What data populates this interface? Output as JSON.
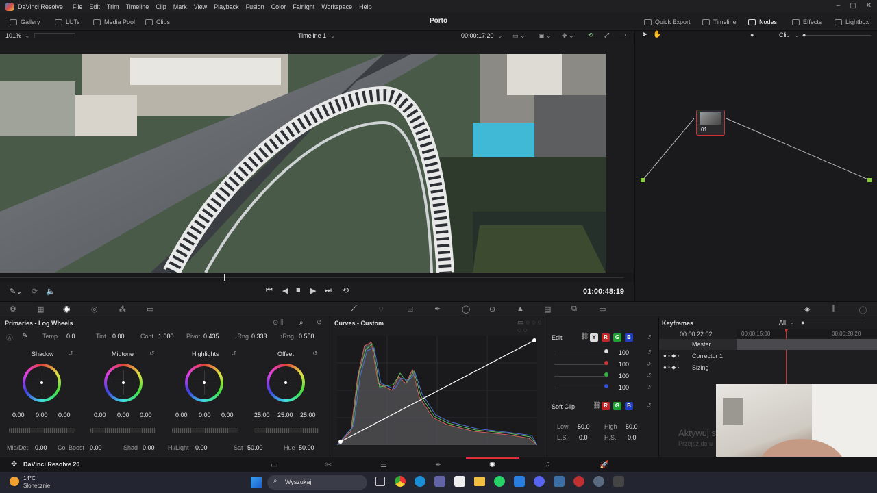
{
  "app": {
    "name": "DaVinci Resolve",
    "menus": [
      "File",
      "Edit",
      "Trim",
      "Timeline",
      "Clip",
      "Mark",
      "View",
      "Playback",
      "Fusion",
      "Color",
      "Fairlight",
      "Workspace",
      "Help"
    ]
  },
  "toolbar": {
    "left": [
      "Gallery",
      "LUTs",
      "Media Pool",
      "Clips"
    ],
    "project": "Porto",
    "right": [
      "Quick Export",
      "Timeline",
      "Nodes",
      "Effects",
      "Lightbox"
    ]
  },
  "viewer": {
    "zoom": "101%",
    "timeline": "Timeline 1",
    "timecode": "00:00:17:20",
    "clip_mode": "Clip",
    "playhead_tc": "01:00:48:19"
  },
  "node": {
    "label": "01"
  },
  "primaries": {
    "title": "Primaries - Log Wheels",
    "temp_label": "Temp",
    "temp": "0.0",
    "tint_label": "Tint",
    "tint": "0.00",
    "cont_label": "Cont",
    "cont": "1.000",
    "pivot_label": "Pivot",
    "pivot": "0.435",
    "lrng_label": "↓Rng",
    "lrng": "0.333",
    "hrng_label": "↑Rng",
    "hrng": "0.550",
    "wheels": [
      {
        "name": "Shadow",
        "v": [
          "0.00",
          "0.00",
          "0.00"
        ]
      },
      {
        "name": "Midtone",
        "v": [
          "0.00",
          "0.00",
          "0.00"
        ]
      },
      {
        "name": "Highlights",
        "v": [
          "0.00",
          "0.00",
          "0.00"
        ]
      },
      {
        "name": "Offset",
        "v": [
          "25.00",
          "25.00",
          "25.00"
        ]
      }
    ],
    "middet_label": "Mid/Det",
    "middet": "0.00",
    "colboost_label": "Col Boost",
    "colboost": "0.00",
    "shad_label": "Shad",
    "shad": "0.00",
    "hilight_label": "Hi/Light",
    "hilight": "0.00",
    "sat_label": "Sat",
    "sat": "50.00",
    "hue_label": "Hue",
    "hue": "50.00"
  },
  "curves": {
    "title": "Curves - Custom"
  },
  "edit": {
    "label": "Edit",
    "channels": [
      "Y",
      "R",
      "G",
      "B"
    ],
    "values": [
      "100",
      "100",
      "100",
      "100"
    ],
    "softclip": "Soft Clip",
    "low_label": "Low",
    "low": "50.0",
    "high_label": "High",
    "high": "50.0",
    "ls_label": "L.S.",
    "ls": "0.0",
    "hs_label": "H.S.",
    "hs": "0.0"
  },
  "keyframes": {
    "title": "Keyframes",
    "filter": "All",
    "tc": "00:00:22:02",
    "ruler1": "00:00:15:00",
    "ruler2": "00:00:28:20",
    "tracks": [
      "Master",
      "Corrector 1",
      "Sizing"
    ],
    "watermark1": "Aktywuj s",
    "watermark2": "Przejdź do u"
  },
  "pagebar": {
    "app_version": "DaVinci Resolve 20"
  },
  "taskbar": {
    "weather_temp": "14°C",
    "weather_desc": "Słonecznie",
    "search": "Wyszukaj"
  },
  "colors": {
    "accent": "#e0303a",
    "wheel_red": "#e04040",
    "curve": "#ffffff"
  }
}
